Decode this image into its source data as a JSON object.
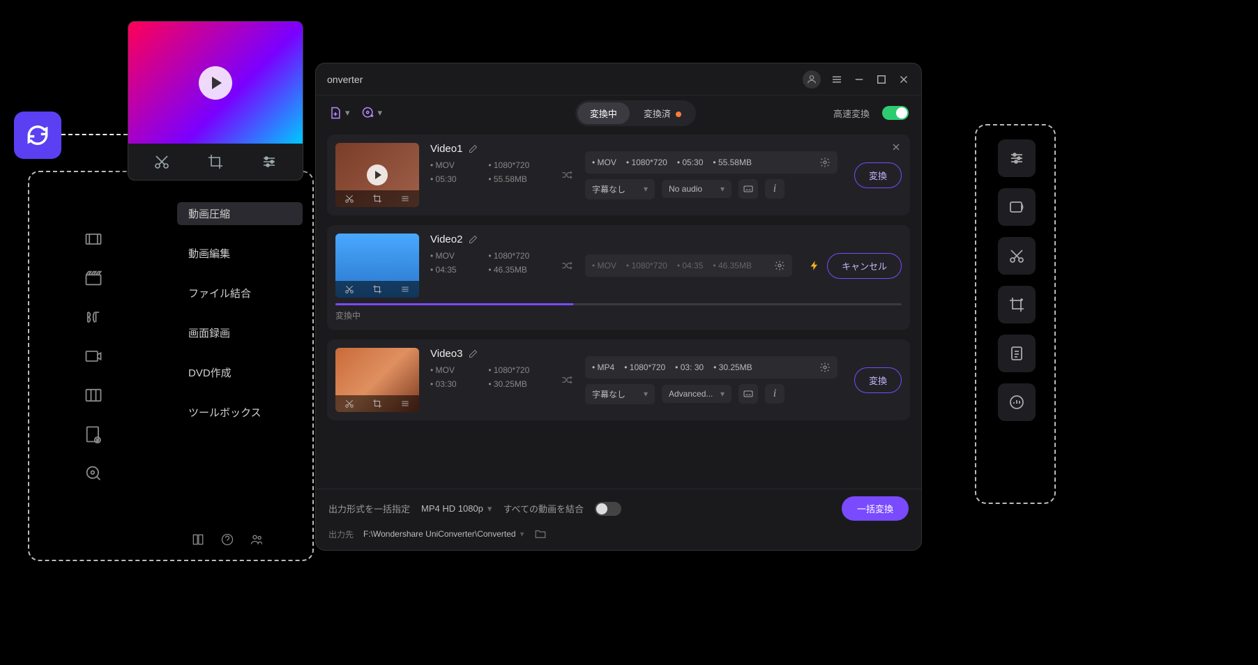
{
  "sync_icon": "sync",
  "preview": {
    "tools": [
      "cut",
      "crop",
      "sliders"
    ]
  },
  "left_tools": [
    "video-compress",
    "clapper",
    "gif",
    "record",
    "columns",
    "doc-play",
    "disc-search"
  ],
  "sidebar": {
    "items": [
      {
        "label": "動画圧縮"
      },
      {
        "label": "動画編集"
      },
      {
        "label": "ファイル結合"
      },
      {
        "label": "画面録画"
      },
      {
        "label": "DVD作成"
      },
      {
        "label": "ツールボックス"
      }
    ],
    "footer": [
      "book",
      "help",
      "people"
    ]
  },
  "window": {
    "title": "onverter",
    "toolbar": {
      "tabs": {
        "converting": "変換中",
        "converted": "変換済"
      },
      "fast_label": "高速変換"
    },
    "videos": [
      {
        "name": "Video1",
        "meta": {
          "fmt": "MOV",
          "res": "1080*720",
          "dur": "05:30",
          "size": "55.58MB"
        },
        "out": {
          "fmt": "MOV",
          "res": "1080*720",
          "dur": "05:30",
          "size": "55.58MB"
        },
        "subtitle": "字幕なし",
        "audio": "No audio",
        "action": "変換",
        "closable": true
      },
      {
        "name": "Video2",
        "meta": {
          "fmt": "MOV",
          "res": "1080*720",
          "dur": "04:35",
          "size": "46.35MB"
        },
        "out": {
          "fmt": "MOV",
          "res": "1080*720",
          "dur": "04:35",
          "size": "46.35MB"
        },
        "action": "キャンセル",
        "progress_label": "変換中",
        "has_bolt": true,
        "dim": true
      },
      {
        "name": "Video3",
        "meta": {
          "fmt": "MOV",
          "res": "1080*720",
          "dur": "03:30",
          "size": "30.25MB"
        },
        "out": {
          "fmt": "MP4",
          "res": "1080*720",
          "dur": "03: 30",
          "size": "30.25MB"
        },
        "subtitle": "字幕なし",
        "audio": "Advanced...",
        "action": "変換"
      }
    ],
    "bottom": {
      "format_label": "出力形式を一括指定",
      "format_value": "MP4 HD 1080p",
      "merge_label": "すべての動画を結合",
      "batch_btn": "一括変換",
      "output_label": "出力先",
      "output_path": "F:\\Wondershare UniConverter\\Converted"
    }
  },
  "right_tools": [
    "sliders",
    "image-swap",
    "cut",
    "crop-plus",
    "doc-lines",
    "chart-circle"
  ]
}
